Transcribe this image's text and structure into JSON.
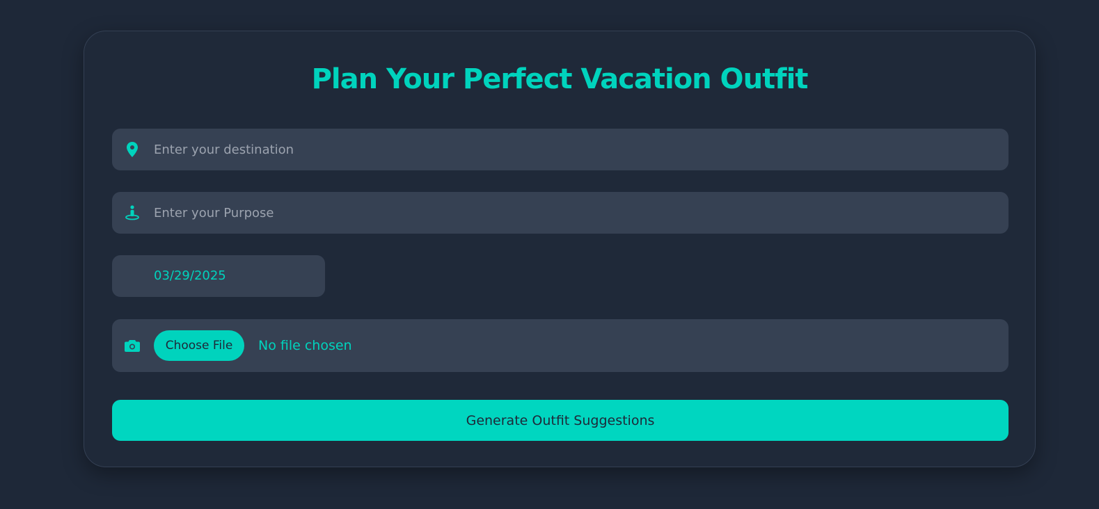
{
  "page": {
    "title": "Plan Your Perfect Vacation Outfit"
  },
  "form": {
    "destination": {
      "placeholder": "Enter your destination",
      "icon": "map-pin-icon"
    },
    "purpose": {
      "placeholder": "Enter your Purpose",
      "icon": "person-icon"
    },
    "date": {
      "value": "03/29/2025"
    },
    "file": {
      "icon": "camera-icon",
      "button_label": "Choose File",
      "status": "No file chosen"
    },
    "submit_label": "Generate Outfit Suggestions"
  },
  "colors": {
    "background": "#1e2838",
    "card": "#1f2939",
    "field": "#364153",
    "accent": "#00d3bd"
  }
}
